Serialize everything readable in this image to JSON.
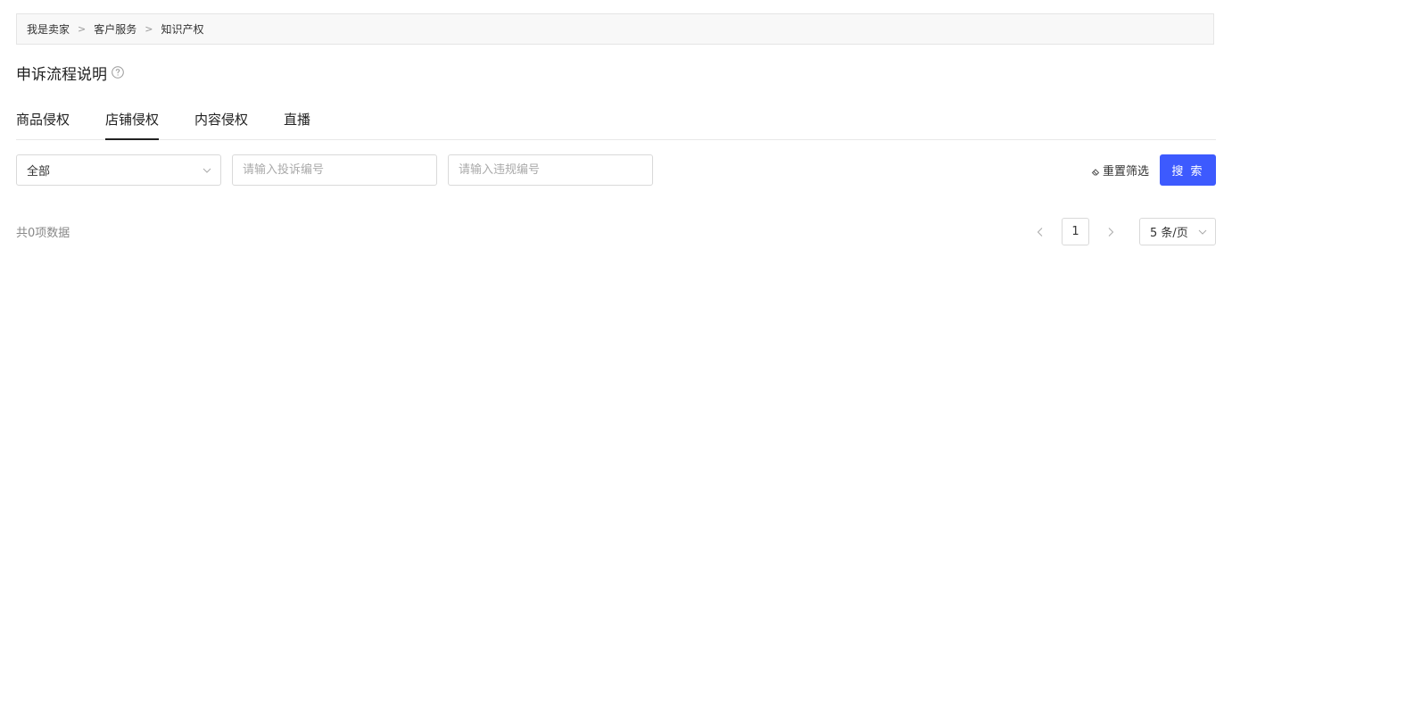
{
  "breadcrumb": {
    "items": [
      "我是卖家",
      "客户服务",
      "知识产权"
    ],
    "separator": ">"
  },
  "page": {
    "title": "申诉流程说明",
    "help_icon": "question-circle-icon"
  },
  "tabs": [
    {
      "label": "商品侵权",
      "active": false
    },
    {
      "label": "店铺侵权",
      "active": true
    },
    {
      "label": "内容侵权",
      "active": false
    },
    {
      "label": "直播",
      "active": false
    }
  ],
  "filters": {
    "status_select": {
      "value": "全部"
    },
    "complaint_input": {
      "placeholder": "请输入投诉编号",
      "value": ""
    },
    "violation_input": {
      "placeholder": "请输入违规编号",
      "value": ""
    },
    "reset_label": "重置筛选",
    "search_label": "搜 索"
  },
  "results": {
    "total_text": "共0项数据"
  },
  "pagination": {
    "current_page": "1",
    "page_size": "5 条/页"
  },
  "colors": {
    "primary": "#3d5afe",
    "border": "#d9d9d9",
    "breadcrumb_bg": "#f8f8f8",
    "muted_text": "#888888"
  }
}
